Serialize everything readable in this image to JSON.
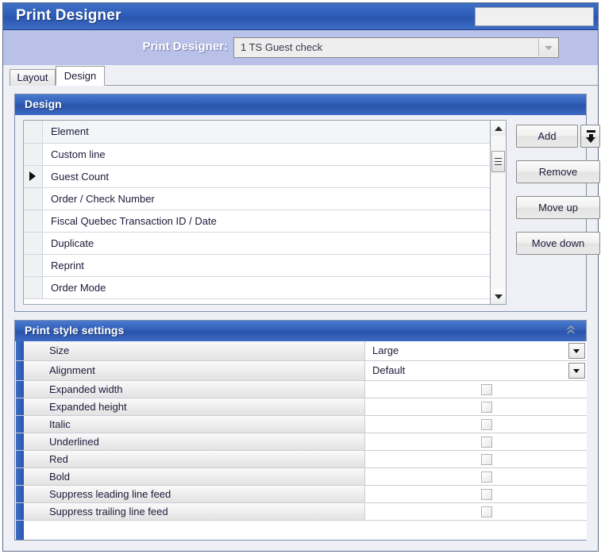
{
  "window": {
    "title": "Print Designer",
    "title_field_value": ""
  },
  "subheader": {
    "label": "Print Designer:",
    "combo_value": "1 TS Guest check",
    "combo_icon": "chevron-down-icon"
  },
  "tabs": [
    {
      "label": "Layout",
      "active": false
    },
    {
      "label": "Design",
      "active": true
    }
  ],
  "design_panel": {
    "title": "Design",
    "column_header": "Element",
    "rows": [
      {
        "label": "Custom line",
        "selected": false
      },
      {
        "label": "Guest Count",
        "selected": true
      },
      {
        "label": "Order / Check Number",
        "selected": false
      },
      {
        "label": "Fiscal Quebec Transaction ID / Date",
        "selected": false
      },
      {
        "label": "Duplicate",
        "selected": false
      },
      {
        "label": "Reprint",
        "selected": false
      },
      {
        "label": "Order Mode",
        "selected": false
      }
    ],
    "buttons": {
      "add": "Add",
      "add_dropdown_icon": "add-to-bottom-arrow-icon",
      "remove": "Remove",
      "move_up": "Move up",
      "move_down": "Move down"
    },
    "scrollbar": {
      "up_icon": "scroll-up-arrow-icon",
      "down_icon": "scroll-down-arrow-icon",
      "thumb_icon": "scroll-thumb-grip-icon"
    }
  },
  "settings_panel": {
    "title": "Print style settings",
    "collapse_icon": "chevron-double-up-icon",
    "collapse_glyph": "«",
    "rows": [
      {
        "name": "Size",
        "type": "dropdown",
        "value": "Large"
      },
      {
        "name": "Alignment",
        "type": "dropdown",
        "value": "Default"
      },
      {
        "name": "Expanded width",
        "type": "checkbox",
        "checked": false
      },
      {
        "name": "Expanded height",
        "type": "checkbox",
        "checked": false
      },
      {
        "name": "Italic",
        "type": "checkbox",
        "checked": false
      },
      {
        "name": "Underlined",
        "type": "checkbox",
        "checked": false
      },
      {
        "name": "Red",
        "type": "checkbox",
        "checked": false
      },
      {
        "name": "Bold",
        "type": "checkbox",
        "checked": false
      },
      {
        "name": "Suppress leading line feed",
        "type": "checkbox",
        "checked": false
      },
      {
        "name": "Suppress trailing line feed",
        "type": "checkbox",
        "checked": false
      }
    ]
  },
  "colors": {
    "title_blue": "#2f5ebb",
    "subheader_periwinkle": "#b9c1e9",
    "panel_background": "#eef0f5",
    "accent_bar": "#2a55ae",
    "collapse_chevron": "#b7b59a"
  }
}
